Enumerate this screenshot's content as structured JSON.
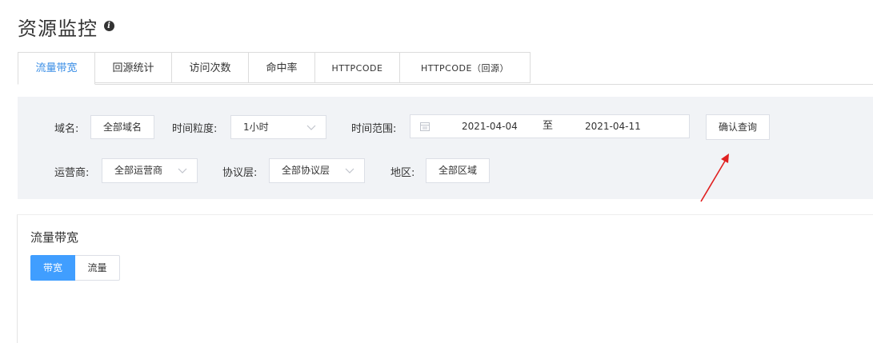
{
  "page": {
    "title": "资源监控"
  },
  "tabs": [
    {
      "label": "流量带宽",
      "active": true
    },
    {
      "label": "回源统计"
    },
    {
      "label": "访问次数"
    },
    {
      "label": "命中率"
    },
    {
      "label": "HTTPCODE"
    },
    {
      "label": "HTTPCODE（回源）"
    }
  ],
  "filters": {
    "domain": {
      "label": "域名:",
      "value": "全部域名"
    },
    "granularity": {
      "label": "时间粒度:",
      "value": "1小时"
    },
    "time_range": {
      "label": "时间范围:",
      "start": "2021-04-04",
      "separator": "至",
      "end": "2021-04-11"
    },
    "confirm_label": "确认查询",
    "isp": {
      "label": "运营商:",
      "value": "全部运营商"
    },
    "protocol": {
      "label": "协议层:",
      "value": "全部协议层"
    },
    "region": {
      "label": "地区:",
      "value": "全部区域"
    }
  },
  "content": {
    "section_title": "流量带宽",
    "toggle": [
      {
        "label": "带宽",
        "active": true
      },
      {
        "label": "流量"
      }
    ]
  },
  "colors": {
    "accent": "#409eff",
    "tab_active_text": "#3a8ee6",
    "panel_bg": "#f1f3f6",
    "annotation_arrow": "#e02020"
  },
  "icons": {
    "info": "info-icon",
    "calendar": "calendar-icon",
    "dropdown": "chevron-down-icon",
    "annotation": "red-arrow-annotation"
  }
}
